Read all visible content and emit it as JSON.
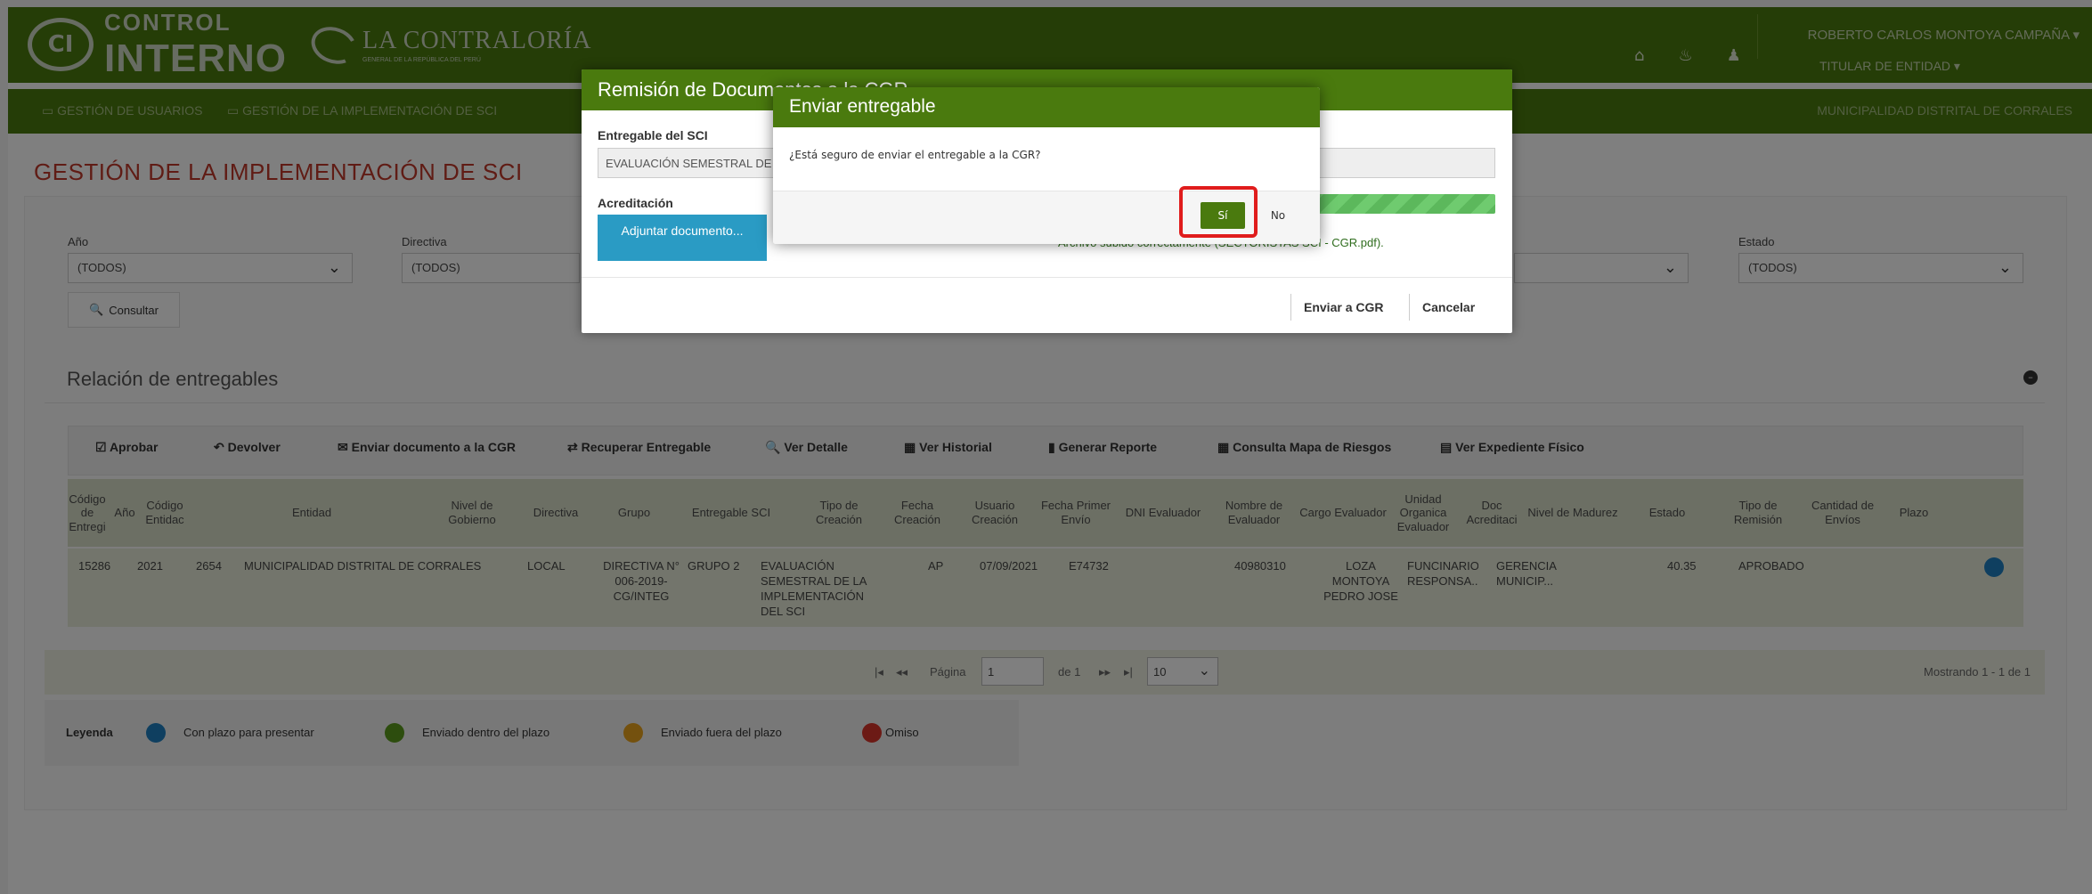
{
  "header": {
    "logo_line1": "CONTROL",
    "logo_line2": "INTERNO",
    "logo_mark": "CI",
    "cgr_name": "LA CONTRALORÍA",
    "cgr_sub": "GENERAL DE LA REPÚBLICA DEL PERÚ",
    "user_name": "ROBERTO CARLOS MONTOYA CAMPAÑA",
    "user_role": "TITULAR DE ENTIDAD",
    "icons": [
      "home-icon",
      "bell-icon",
      "user-icon"
    ]
  },
  "nav": {
    "items": [
      {
        "label": "GESTIÓN DE USUARIOS",
        "icon": "monitor-icon"
      },
      {
        "label": "GESTIÓN DE LA IMPLEMENTACIÓN DE SCI",
        "icon": "monitor-icon"
      }
    ],
    "entity": "MUNICIPALIDAD DISTRITAL DE CORRALES"
  },
  "page": {
    "title": "GESTIÓN DE LA IMPLEMENTACIÓN DE SCI"
  },
  "filters": {
    "anio": {
      "label": "Año",
      "value": "(TODOS)"
    },
    "directiva": {
      "label": "Directiva",
      "value": "(TODOS)"
    },
    "estado": {
      "label": "Estado",
      "value": "(TODOS)"
    },
    "consultar": "Consultar"
  },
  "section": {
    "title": "Relación de entregables"
  },
  "toolbar": [
    {
      "label": "Aprobar",
      "icon": "check-square-icon"
    },
    {
      "label": "Devolver",
      "icon": "undo-icon"
    },
    {
      "label": "Enviar documento a la CGR",
      "icon": "envelope-icon"
    },
    {
      "label": "Recuperar Entregable",
      "icon": "retweet-icon"
    },
    {
      "label": "Ver Detalle",
      "icon": "zoom-icon"
    },
    {
      "label": "Ver Historial",
      "icon": "calendar-icon"
    },
    {
      "label": "Generar Reporte",
      "icon": "bar-chart-icon"
    },
    {
      "label": "Consulta Mapa de Riesgos",
      "icon": "grid-icon"
    },
    {
      "label": "Ver Expediente Físico",
      "icon": "briefcase-icon"
    }
  ],
  "table": {
    "headers": [
      "Código de Entregi",
      "Año",
      "Código Entidac",
      "Entidad",
      "Nivel de Gobierno",
      "Directiva",
      "Grupo",
      "Entregable SCI",
      "Tipo de Creación",
      "Fecha Creación",
      "Usuario Creación",
      "Fecha Primer Envío",
      "DNI Evaluador",
      "Nombre de Evaluador",
      "Cargo Evaluador",
      "Unidad Organica Evaluador",
      "Doc Acreditaci",
      "Nivel de Madurez",
      "Estado",
      "Tipo de Remisión",
      "Cantidad de Envíos",
      "Plazo"
    ],
    "row": [
      "15286",
      "2021",
      "2654",
      "MUNICIPALIDAD DISTRITAL DE CORRALES",
      "LOCAL",
      "DIRECTIVA N° 006-2019-CG/INTEG",
      "GRUPO 2",
      "EVALUACIÓN SEMESTRAL DE LA IMPLEMENTACIÓN DEL SCI",
      "AP",
      "07/09/2021",
      "E74732",
      "",
      "40980310",
      "LOZA MONTOYA PEDRO JOSE",
      "FUNCINARIO RESPONSA...",
      "GERENCIA MUNICIP...",
      "",
      "40.35",
      "APROBADO",
      "",
      ""
    ],
    "plazo_color": "#1f7fc0"
  },
  "pager": {
    "first": "|◂",
    "prev": "◂◂",
    "pagina_label": "Página",
    "page_value": "1",
    "of_label": "de 1",
    "next": "▸▸",
    "last": "▸|",
    "page_size": "10",
    "summary": "Mostrando 1 - 1 de 1"
  },
  "legend": {
    "title": "Leyenda",
    "items": [
      {
        "label": "Con plazo para presentar",
        "color": "#1f7fc0"
      },
      {
        "label": "Enviado dentro del plazo",
        "color": "#5a9b1d"
      },
      {
        "label": "Enviado fuera del plazo",
        "color": "#e8a21c"
      },
      {
        "label": "Omiso",
        "color": "#d9342b"
      }
    ]
  },
  "modal_remision": {
    "title": "Remisión de Documentos a la CGR",
    "entregable_label": "Entregable del SCI",
    "entregable_value": "EVALUACIÓN SEMESTRAL DE LA IMPLEMENTACIÓN DEL SCI",
    "acreditacion_label": "Acreditación",
    "adjuntar": "Adjuntar documento...",
    "upload_progress": 1.0,
    "status": "Archivo subido correctamente (SECTORISTAS SCI - CGR.pdf).",
    "enviar": "Enviar a CGR",
    "cancelar": "Cancelar"
  },
  "modal_confirm": {
    "title": "Enviar entregable",
    "message": "¿Está seguro de enviar el entregable a la CGR?",
    "yes": "Sí",
    "no": "No"
  }
}
